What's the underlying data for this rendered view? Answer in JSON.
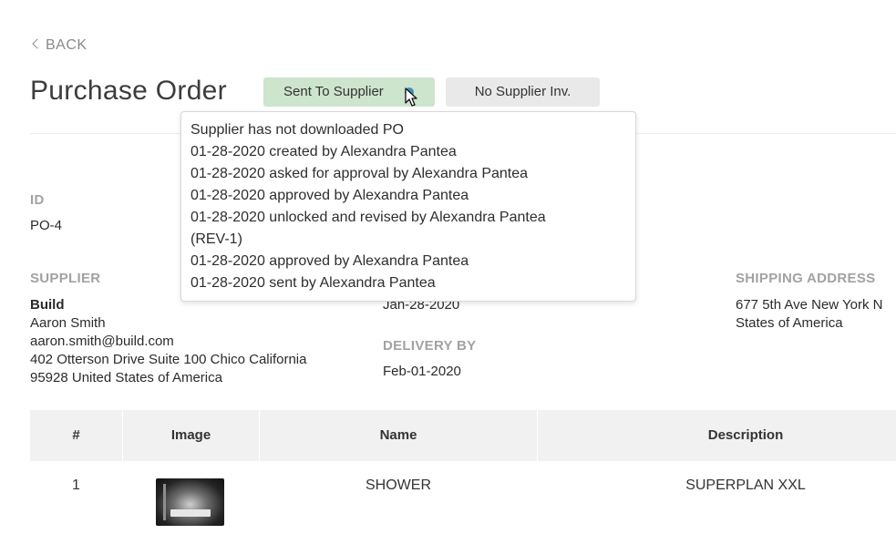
{
  "nav": {
    "back_label": "BACK"
  },
  "page": {
    "title": "Purchase Order"
  },
  "status_buttons": {
    "sent_to_supplier": "Sent To Supplier",
    "no_supplier_inv": "No Supplier Inv."
  },
  "popover": {
    "lines": [
      "Supplier has not downloaded PO",
      "01-28-2020 created by Alexandra Pantea",
      "01-28-2020 asked for approval by Alexandra Pantea",
      "01-28-2020 approved by Alexandra Pantea",
      "01-28-2020 unlocked and revised by Alexandra Pantea",
      "(REV-1)",
      "01-28-2020 approved by Alexandra Pantea",
      "01-28-2020 sent by Alexandra Pantea"
    ]
  },
  "order": {
    "id_label": "ID",
    "id_value": "PO-4",
    "supplier_label": "SUPPLIER",
    "supplier_name": "Build",
    "supplier_contact": "Aaron Smith",
    "supplier_email": "aaron.smith@build.com",
    "supplier_address_1": "402 Otterson Drive Suite 100 Chico California",
    "supplier_address_2": "95928 United States of America",
    "order_date_value": "Jan-28-2020",
    "delivery_label": "DELIVERY BY",
    "delivery_value": "Feb-01-2020",
    "shipping_label": "SHIPPING ADDRESS",
    "shipping_line_1": "677 5th Ave New York N",
    "shipping_line_2": "States of America"
  },
  "table": {
    "headers": [
      "#",
      "Image",
      "Name",
      "Description"
    ],
    "rows": [
      {
        "num": "1",
        "name": "SHOWER",
        "description": "SUPERPLAN XXL"
      }
    ]
  },
  "colors": {
    "sent_button_bg": "#cde4cd",
    "info_dot": "#3f8fb8",
    "label_gray": "#a2a2a2",
    "table_header_bg": "#f1f1f1"
  }
}
